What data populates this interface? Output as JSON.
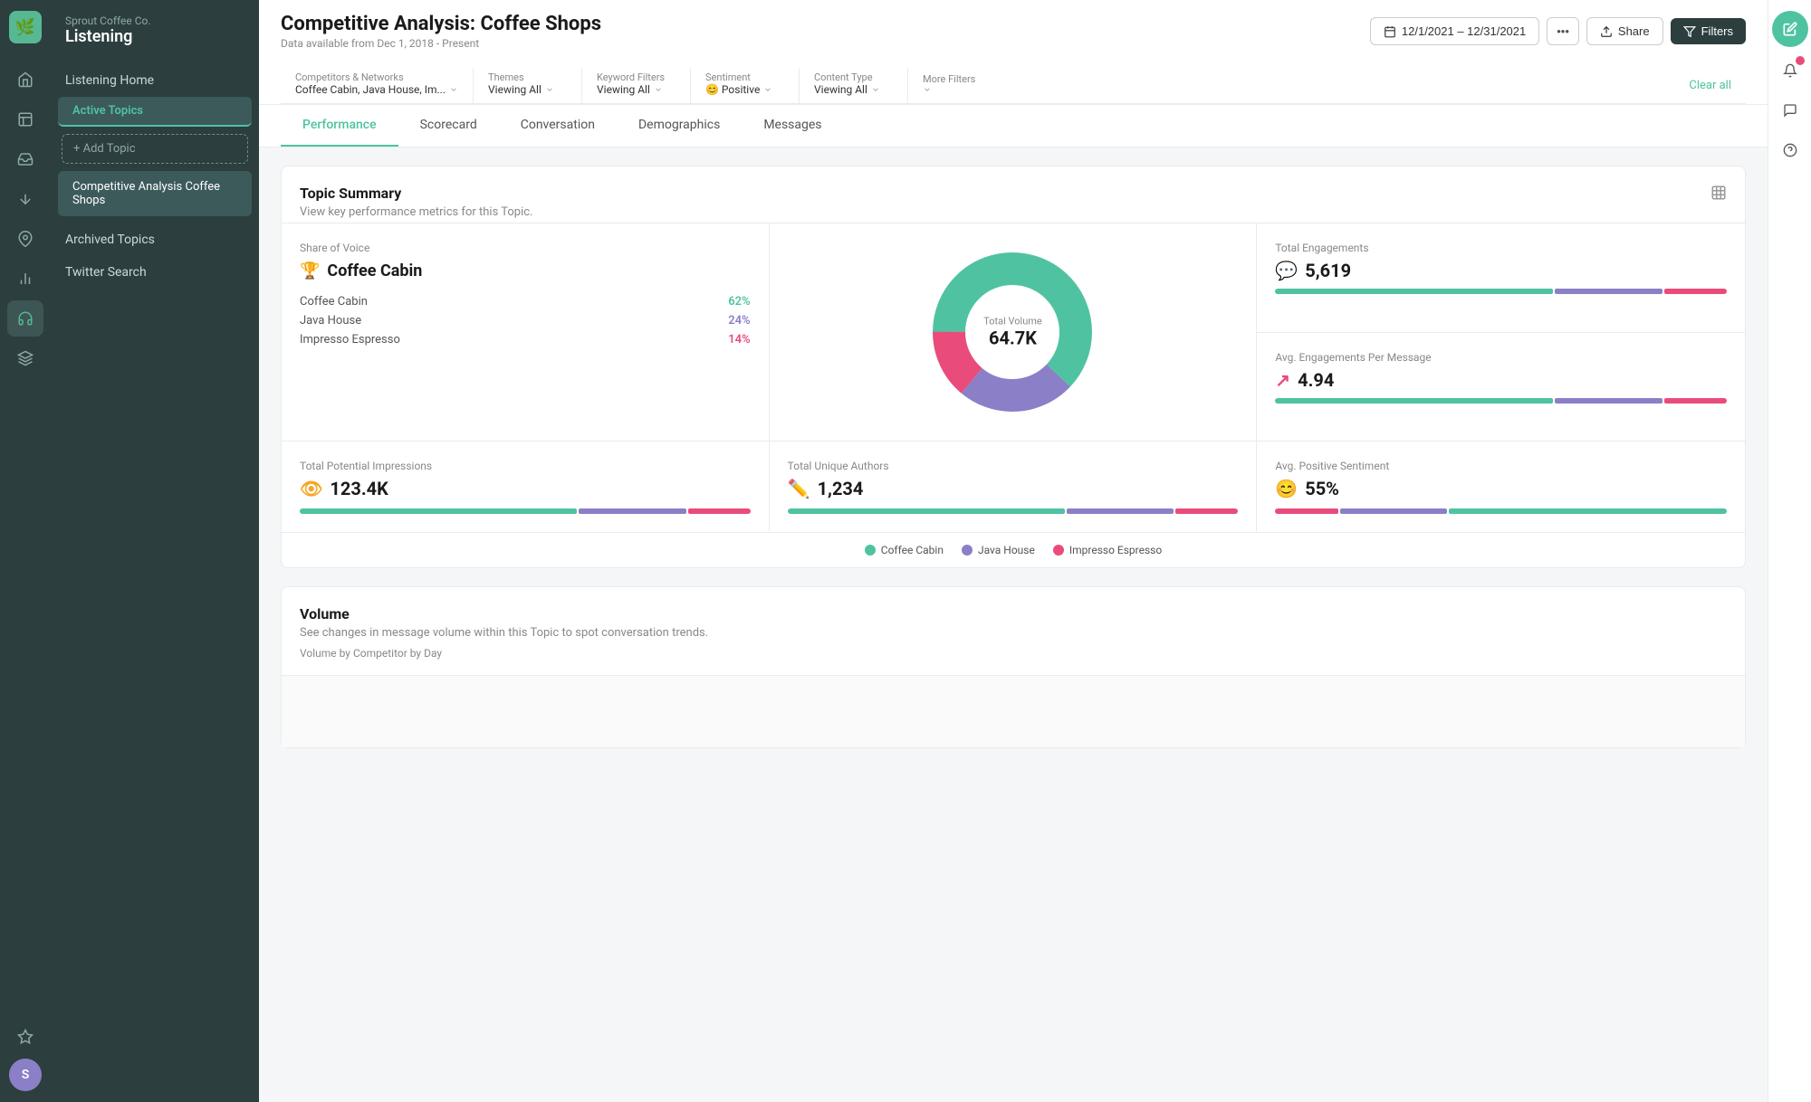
{
  "brand": {
    "company": "Sprout Coffee Co.",
    "product": "Listening"
  },
  "sidebar": {
    "listening_home": "Listening Home",
    "active_topics": "Active Topics",
    "add_topic": "+ Add Topic",
    "current_topic": "Competitive Analysis Coffee Shops",
    "archived_topics": "Archived Topics",
    "twitter_search": "Twitter Search"
  },
  "header": {
    "title": "Competitive Analysis: Coffee Shops",
    "subtitle": "Data available from Dec 1, 2018 - Present",
    "date_range": "12/1/2021 – 12/31/2021",
    "share_label": "Share",
    "filters_label": "Filters"
  },
  "filters": {
    "competitors": {
      "label": "Competitors & Networks",
      "value": "Coffee Cabin, Java House, Im..."
    },
    "themes": {
      "label": "Themes",
      "value": "Viewing All"
    },
    "keyword_filters": {
      "label": "Keyword Filters",
      "value": "Viewing All"
    },
    "sentiment": {
      "label": "Sentiment",
      "value": "😊 Positive"
    },
    "content_type": {
      "label": "Content Type",
      "value": "Viewing All"
    },
    "more_filters": {
      "label": "More Filters",
      "value": ""
    },
    "clear_all": "Clear all"
  },
  "tabs": [
    {
      "id": "performance",
      "label": "Performance",
      "active": true
    },
    {
      "id": "scorecard",
      "label": "Scorecard",
      "active": false
    },
    {
      "id": "conversation",
      "label": "Conversation",
      "active": false
    },
    {
      "id": "demographics",
      "label": "Demographics",
      "active": false
    },
    {
      "id": "messages",
      "label": "Messages",
      "active": false
    }
  ],
  "topic_summary": {
    "title": "Topic Summary",
    "subtitle": "View key performance metrics for this Topic.",
    "share_of_voice": {
      "label": "Share of Voice",
      "winner": "Coffee Cabin",
      "competitors": [
        {
          "name": "Coffee Cabin",
          "pct": "62%",
          "color": "green"
        },
        {
          "name": "Java House",
          "pct": "24%",
          "color": "purple"
        },
        {
          "name": "Impresso Espresso",
          "pct": "14%",
          "color": "red"
        }
      ]
    },
    "donut": {
      "total_label": "Total Volume",
      "total_value": "64.7K",
      "segments": [
        {
          "label": "Coffee Cabin",
          "pct": 62,
          "color": "#4fc3a1"
        },
        {
          "label": "Java House",
          "pct": 24,
          "color": "#8b7fc7"
        },
        {
          "label": "Impresso Espresso",
          "pct": 14,
          "color": "#e94c7b"
        }
      ]
    },
    "total_engagements": {
      "label": "Total Engagements",
      "value": "5,619",
      "bar": [
        62,
        24,
        14
      ]
    },
    "avg_engagements": {
      "label": "Avg. Engagements Per Message",
      "value": "4.94",
      "bar": [
        62,
        24,
        14
      ]
    },
    "total_impressions": {
      "label": "Total Potential Impressions",
      "value": "123.4K",
      "bar": [
        62,
        24,
        14
      ]
    },
    "unique_authors": {
      "label": "Total Unique Authors",
      "value": "1,234",
      "bar": [
        62,
        24,
        14
      ]
    },
    "avg_sentiment": {
      "label": "Avg. Positive Sentiment",
      "value": "55%",
      "bar": [
        14,
        24,
        62
      ]
    }
  },
  "legend": [
    {
      "label": "Coffee Cabin",
      "color": "#4fc3a1"
    },
    {
      "label": "Java House",
      "color": "#8b7fc7"
    },
    {
      "label": "Impresso Espresso",
      "color": "#e94c7b"
    }
  ],
  "volume": {
    "title": "Volume",
    "subtitle": "See changes in message volume within this Topic to spot conversation trends.",
    "chart_label": "Volume by Competitor by Day"
  },
  "icons": {
    "logo": "🌿",
    "home": "🏠",
    "topics": "📋",
    "inbox": "📥",
    "publish": "📤",
    "pin": "📌",
    "reports": "📊",
    "listening_active": "🎧",
    "automation": "⚙️",
    "star": "⭐",
    "bell": "🔔",
    "compose": "✏️",
    "chat": "💬",
    "help": "❓",
    "calendar": "📅",
    "upload": "⬆️",
    "filter_icon": "⚡",
    "trophy": "🏆",
    "chat_bubble": "💬",
    "arrow_up": "↗",
    "eye": "👁",
    "pen": "✏",
    "smile": "😊"
  }
}
